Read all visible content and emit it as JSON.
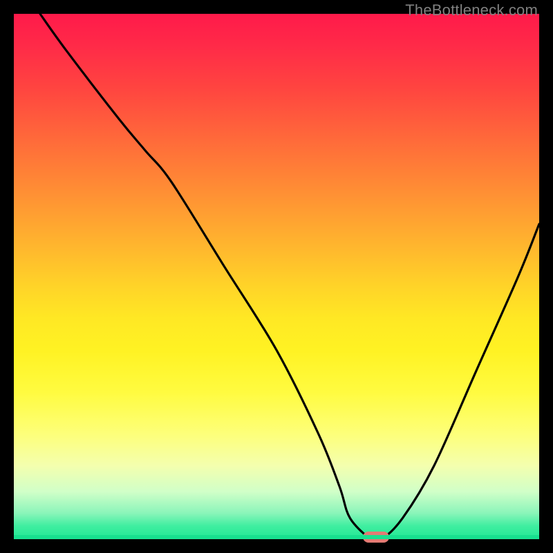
{
  "watermark": "TheBottleneck.com",
  "chart_data": {
    "type": "line",
    "title": "",
    "xlabel": "",
    "ylabel": "",
    "xlim": [
      0,
      100
    ],
    "ylim": [
      0,
      100
    ],
    "background_gradient": {
      "top": "#ff1a4a",
      "mid": "#ffe824",
      "bottom": "#22e895"
    },
    "series": [
      {
        "name": "bottleneck-curve",
        "color": "#000000",
        "x": [
          5,
          10,
          20,
          25,
          30,
          40,
          50,
          58,
          62,
          64,
          68,
          70,
          74,
          80,
          88,
          96,
          100
        ],
        "values": [
          100,
          93,
          80,
          74,
          68,
          52,
          36,
          20,
          10,
          4,
          0,
          0,
          4,
          14,
          32,
          50,
          60
        ]
      }
    ],
    "marker": {
      "x": 69,
      "y": 0,
      "color": "#e37b74"
    }
  }
}
